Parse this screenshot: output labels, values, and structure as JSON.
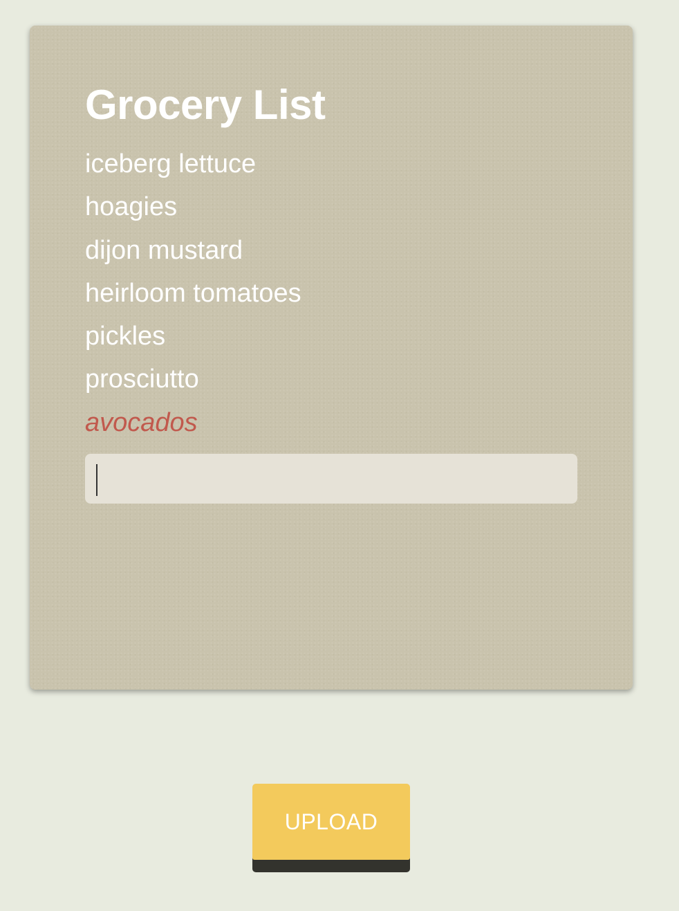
{
  "list": {
    "title": "Grocery List",
    "items": [
      "iceberg lettuce",
      "hoagies",
      "dijon mustard",
      "heirloom tomatoes",
      "pickles",
      "prosciutto",
      "avocados"
    ],
    "highlighted_item_color": "#c1594d",
    "input_value": "",
    "input_placeholder": ""
  },
  "actions": {
    "upload_label": "UPLOAD",
    "upload_color": "#f3ca5c"
  },
  "colors": {
    "page_background": "#e8ebdf",
    "card_background": "#c9c3ad"
  }
}
